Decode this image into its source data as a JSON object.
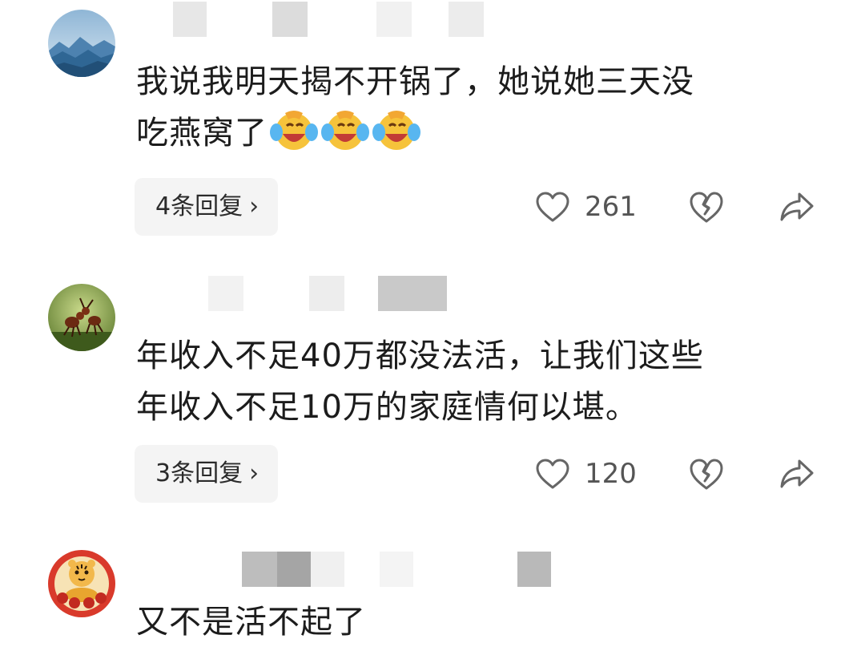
{
  "comments": [
    {
      "text_line1": "我说我明天揭不开锅了，她说她三天没",
      "text_line2": "吃燕窝了",
      "reply_label": "4条回复",
      "like_count": "261"
    },
    {
      "text_line1": "年收入不足40万都没法活，让我们这些",
      "text_line2": "年收入不足10万的家庭情何以堪。",
      "reply_label": "3条回复",
      "like_count": "120"
    },
    {
      "text_line1": "又不是活不起了"
    }
  ],
  "icons": {
    "chevron": "›",
    "like": "heart-outline-icon",
    "dislike": "broken-heart-icon",
    "share": "share-arrow-icon"
  },
  "colors": {
    "reply_bg": "#f4f4f4",
    "text": "#1c1c1c",
    "icon": "#666666"
  }
}
